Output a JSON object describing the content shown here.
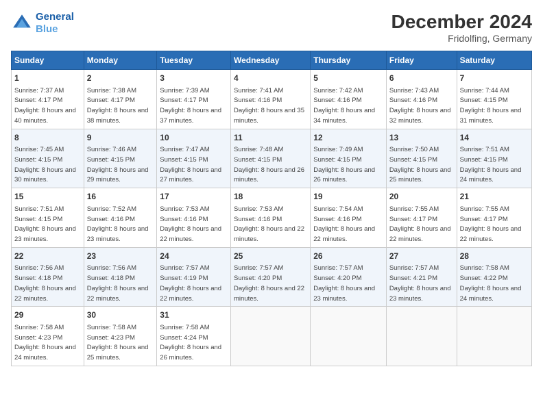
{
  "header": {
    "logo_line1": "General",
    "logo_line2": "Blue",
    "main_title": "December 2024",
    "sub_title": "Fridolfing, Germany"
  },
  "days_of_week": [
    "Sunday",
    "Monday",
    "Tuesday",
    "Wednesday",
    "Thursday",
    "Friday",
    "Saturday"
  ],
  "weeks": [
    [
      {
        "day": 1,
        "sunrise": "Sunrise: 7:37 AM",
        "sunset": "Sunset: 4:17 PM",
        "daylight": "Daylight: 8 hours and 40 minutes."
      },
      {
        "day": 2,
        "sunrise": "Sunrise: 7:38 AM",
        "sunset": "Sunset: 4:17 PM",
        "daylight": "Daylight: 8 hours and 38 minutes."
      },
      {
        "day": 3,
        "sunrise": "Sunrise: 7:39 AM",
        "sunset": "Sunset: 4:17 PM",
        "daylight": "Daylight: 8 hours and 37 minutes."
      },
      {
        "day": 4,
        "sunrise": "Sunrise: 7:41 AM",
        "sunset": "Sunset: 4:16 PM",
        "daylight": "Daylight: 8 hours and 35 minutes."
      },
      {
        "day": 5,
        "sunrise": "Sunrise: 7:42 AM",
        "sunset": "Sunset: 4:16 PM",
        "daylight": "Daylight: 8 hours and 34 minutes."
      },
      {
        "day": 6,
        "sunrise": "Sunrise: 7:43 AM",
        "sunset": "Sunset: 4:16 PM",
        "daylight": "Daylight: 8 hours and 32 minutes."
      },
      {
        "day": 7,
        "sunrise": "Sunrise: 7:44 AM",
        "sunset": "Sunset: 4:15 PM",
        "daylight": "Daylight: 8 hours and 31 minutes."
      }
    ],
    [
      {
        "day": 8,
        "sunrise": "Sunrise: 7:45 AM",
        "sunset": "Sunset: 4:15 PM",
        "daylight": "Daylight: 8 hours and 30 minutes."
      },
      {
        "day": 9,
        "sunrise": "Sunrise: 7:46 AM",
        "sunset": "Sunset: 4:15 PM",
        "daylight": "Daylight: 8 hours and 29 minutes."
      },
      {
        "day": 10,
        "sunrise": "Sunrise: 7:47 AM",
        "sunset": "Sunset: 4:15 PM",
        "daylight": "Daylight: 8 hours and 27 minutes."
      },
      {
        "day": 11,
        "sunrise": "Sunrise: 7:48 AM",
        "sunset": "Sunset: 4:15 PM",
        "daylight": "Daylight: 8 hours and 26 minutes."
      },
      {
        "day": 12,
        "sunrise": "Sunrise: 7:49 AM",
        "sunset": "Sunset: 4:15 PM",
        "daylight": "Daylight: 8 hours and 26 minutes."
      },
      {
        "day": 13,
        "sunrise": "Sunrise: 7:50 AM",
        "sunset": "Sunset: 4:15 PM",
        "daylight": "Daylight: 8 hours and 25 minutes."
      },
      {
        "day": 14,
        "sunrise": "Sunrise: 7:51 AM",
        "sunset": "Sunset: 4:15 PM",
        "daylight": "Daylight: 8 hours and 24 minutes."
      }
    ],
    [
      {
        "day": 15,
        "sunrise": "Sunrise: 7:51 AM",
        "sunset": "Sunset: 4:15 PM",
        "daylight": "Daylight: 8 hours and 23 minutes."
      },
      {
        "day": 16,
        "sunrise": "Sunrise: 7:52 AM",
        "sunset": "Sunset: 4:16 PM",
        "daylight": "Daylight: 8 hours and 23 minutes."
      },
      {
        "day": 17,
        "sunrise": "Sunrise: 7:53 AM",
        "sunset": "Sunset: 4:16 PM",
        "daylight": "Daylight: 8 hours and 22 minutes."
      },
      {
        "day": 18,
        "sunrise": "Sunrise: 7:53 AM",
        "sunset": "Sunset: 4:16 PM",
        "daylight": "Daylight: 8 hours and 22 minutes."
      },
      {
        "day": 19,
        "sunrise": "Sunrise: 7:54 AM",
        "sunset": "Sunset: 4:16 PM",
        "daylight": "Daylight: 8 hours and 22 minutes."
      },
      {
        "day": 20,
        "sunrise": "Sunrise: 7:55 AM",
        "sunset": "Sunset: 4:17 PM",
        "daylight": "Daylight: 8 hours and 22 minutes."
      },
      {
        "day": 21,
        "sunrise": "Sunrise: 7:55 AM",
        "sunset": "Sunset: 4:17 PM",
        "daylight": "Daylight: 8 hours and 22 minutes."
      }
    ],
    [
      {
        "day": 22,
        "sunrise": "Sunrise: 7:56 AM",
        "sunset": "Sunset: 4:18 PM",
        "daylight": "Daylight: 8 hours and 22 minutes."
      },
      {
        "day": 23,
        "sunrise": "Sunrise: 7:56 AM",
        "sunset": "Sunset: 4:18 PM",
        "daylight": "Daylight: 8 hours and 22 minutes."
      },
      {
        "day": 24,
        "sunrise": "Sunrise: 7:57 AM",
        "sunset": "Sunset: 4:19 PM",
        "daylight": "Daylight: 8 hours and 22 minutes."
      },
      {
        "day": 25,
        "sunrise": "Sunrise: 7:57 AM",
        "sunset": "Sunset: 4:20 PM",
        "daylight": "Daylight: 8 hours and 22 minutes."
      },
      {
        "day": 26,
        "sunrise": "Sunrise: 7:57 AM",
        "sunset": "Sunset: 4:20 PM",
        "daylight": "Daylight: 8 hours and 23 minutes."
      },
      {
        "day": 27,
        "sunrise": "Sunrise: 7:57 AM",
        "sunset": "Sunset: 4:21 PM",
        "daylight": "Daylight: 8 hours and 23 minutes."
      },
      {
        "day": 28,
        "sunrise": "Sunrise: 7:58 AM",
        "sunset": "Sunset: 4:22 PM",
        "daylight": "Daylight: 8 hours and 24 minutes."
      }
    ],
    [
      {
        "day": 29,
        "sunrise": "Sunrise: 7:58 AM",
        "sunset": "Sunset: 4:23 PM",
        "daylight": "Daylight: 8 hours and 24 minutes."
      },
      {
        "day": 30,
        "sunrise": "Sunrise: 7:58 AM",
        "sunset": "Sunset: 4:23 PM",
        "daylight": "Daylight: 8 hours and 25 minutes."
      },
      {
        "day": 31,
        "sunrise": "Sunrise: 7:58 AM",
        "sunset": "Sunset: 4:24 PM",
        "daylight": "Daylight: 8 hours and 26 minutes."
      },
      null,
      null,
      null,
      null
    ]
  ]
}
